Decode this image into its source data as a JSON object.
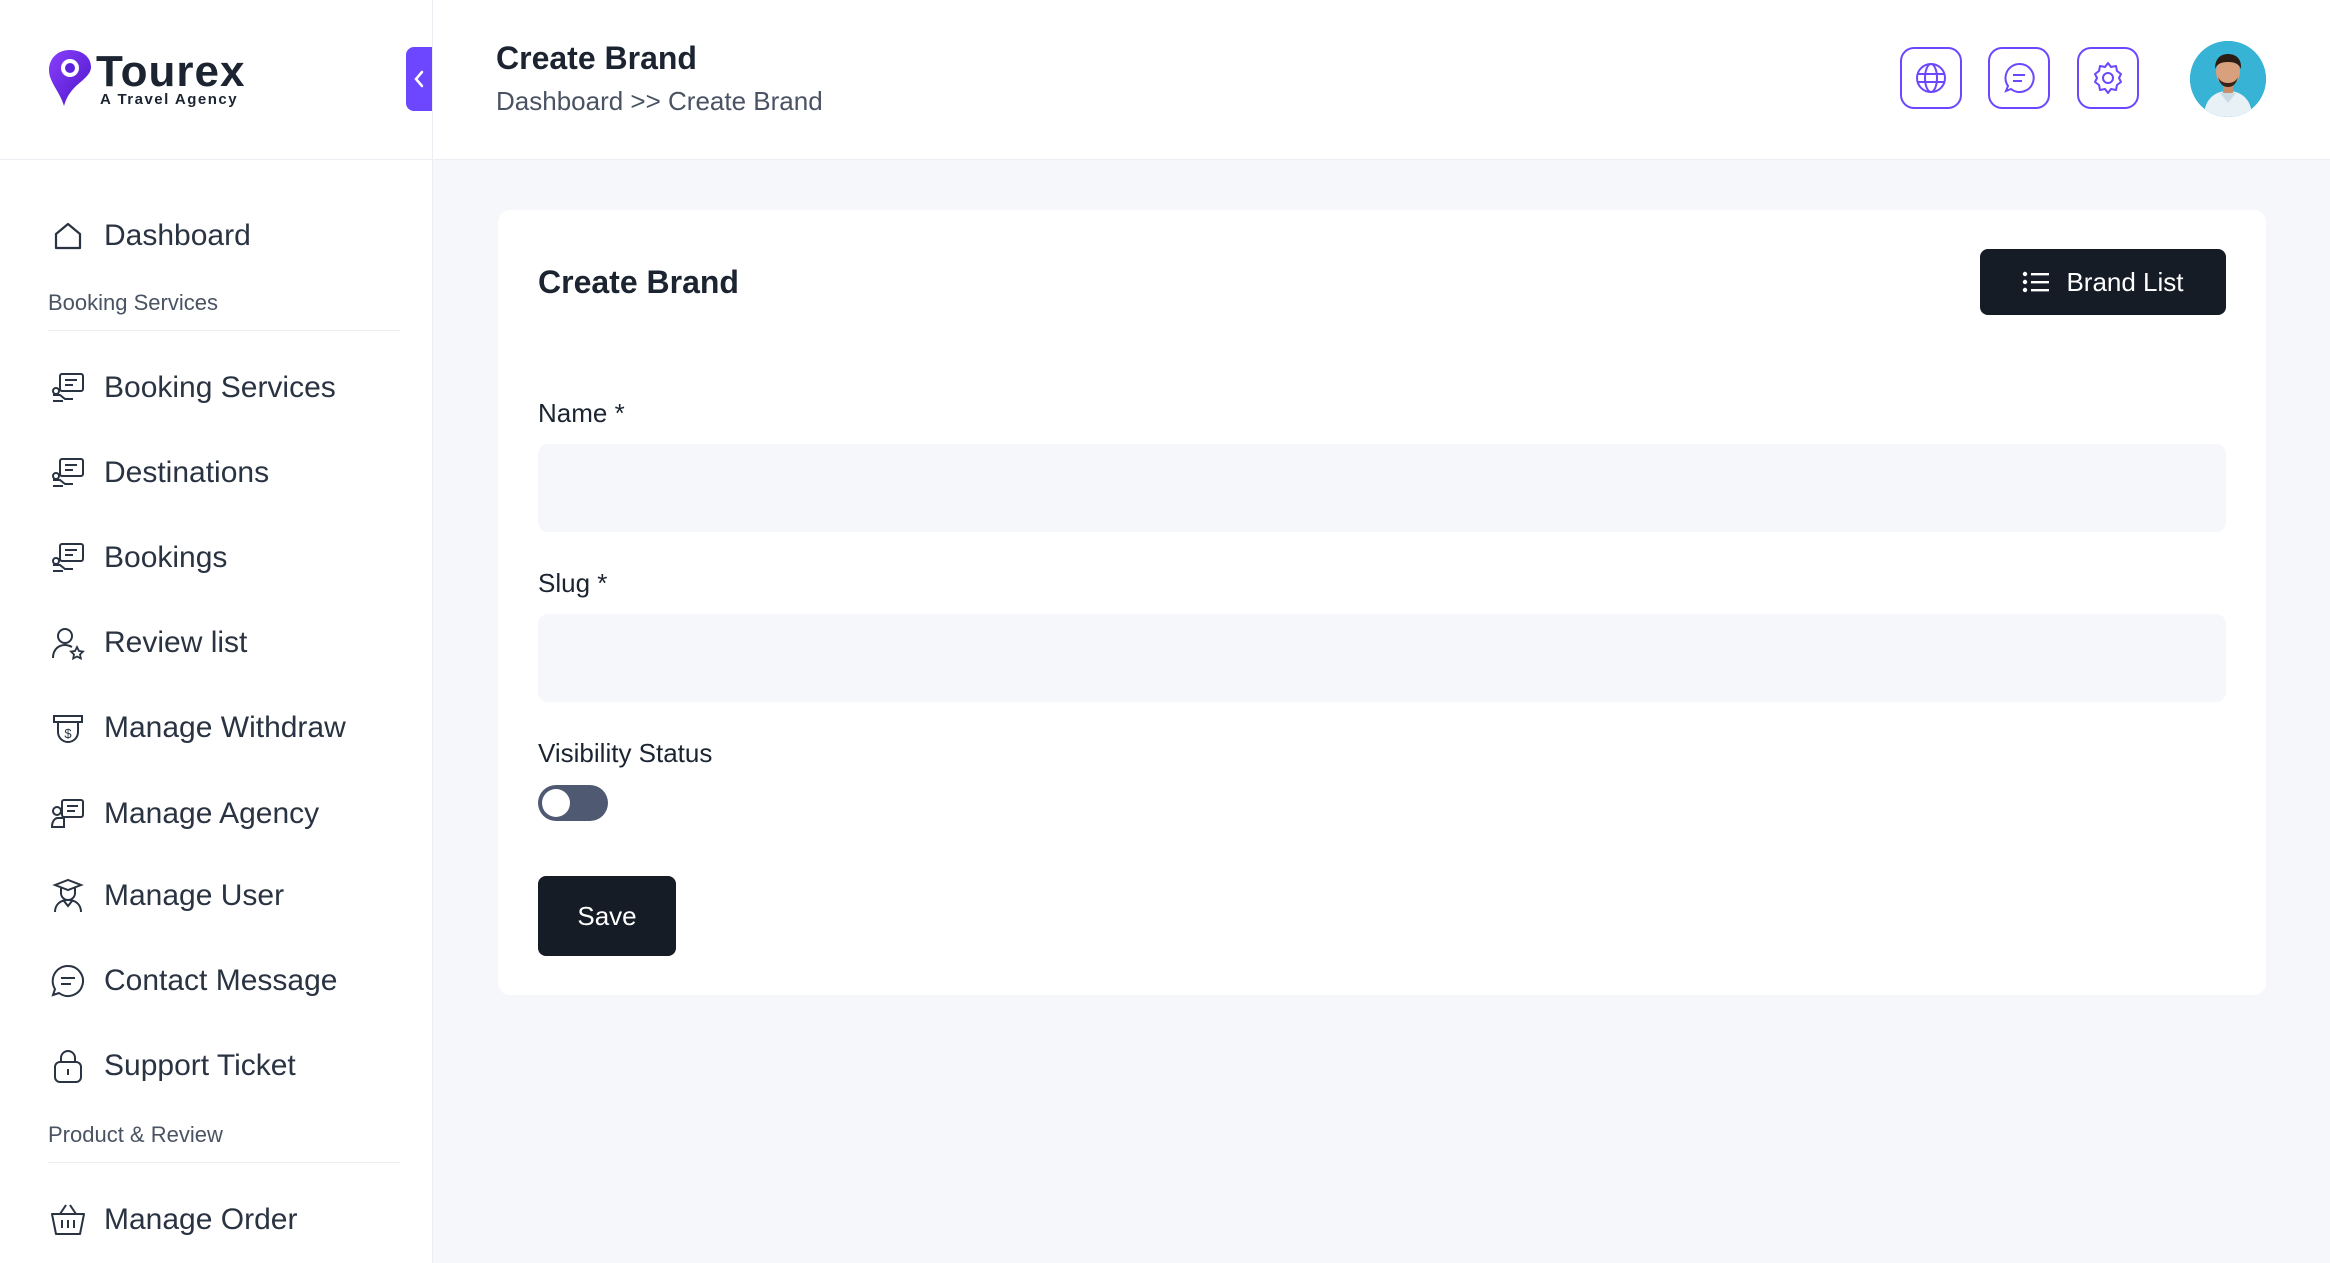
{
  "brand": {
    "name": "Tourex",
    "tagline": "A Travel Agency",
    "accent": "#6c47ff"
  },
  "sidebar": {
    "items": [
      {
        "label": "Dashboard",
        "icon": "home-icon"
      },
      {
        "label": "Booking Services",
        "icon": "chat-hand-icon"
      },
      {
        "label": "Destinations",
        "icon": "chat-hand-icon"
      },
      {
        "label": "Bookings",
        "icon": "chat-hand-icon"
      },
      {
        "label": "Review list",
        "icon": "user-star-icon"
      },
      {
        "label": "Manage Withdraw",
        "icon": "money-bag-icon"
      },
      {
        "label": "Manage Agency",
        "icon": "agency-icon"
      },
      {
        "label": "Manage User",
        "icon": "user-grad-icon"
      },
      {
        "label": "Contact Message",
        "icon": "message-icon"
      },
      {
        "label": "Support Ticket",
        "icon": "lock-icon"
      },
      {
        "label": "Manage Order",
        "icon": "basket-icon"
      }
    ],
    "sections": [
      "Booking Services",
      "Product & Review"
    ]
  },
  "header": {
    "title": "Create Brand",
    "breadcrumb": "Dashboard >> Create Brand",
    "actions": [
      "globe-icon",
      "chat-icon",
      "gear-icon"
    ]
  },
  "card": {
    "title": "Create Brand",
    "brand_list_label": "Brand List",
    "name_label": "Name *",
    "name_value": "",
    "slug_label": "Slug *",
    "slug_value": "",
    "visibility_label": "Visibility Status",
    "visibility_on": false,
    "save_label": "Save"
  },
  "colors": {
    "dark_button": "#151c26",
    "toggle_off": "#4f5a72",
    "input_bg": "#f6f7fb"
  }
}
